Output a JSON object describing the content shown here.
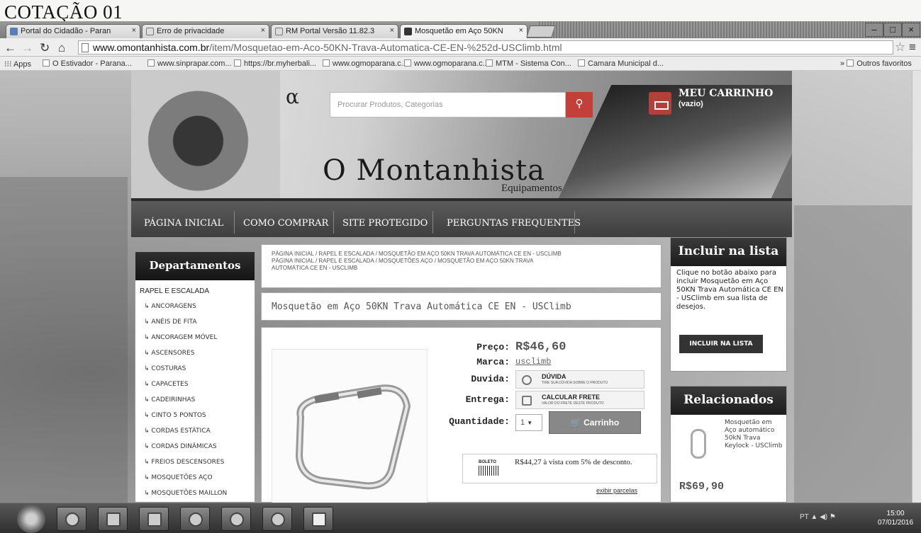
{
  "heading": "COTAÇÃO 01",
  "browser": {
    "tabs": [
      {
        "label": "Portal do Cidadão - Paran"
      },
      {
        "label": "Erro de privacidade"
      },
      {
        "label": "RM Portal Versão 11.82.3"
      },
      {
        "label": "Mosquetão em Aço 50KN"
      }
    ],
    "url_domain": "www.omontanhista.com.br",
    "url_path": "/item/Mosquetao-em-Aco-50KN-Trava-Automatica-CE-EN-%252d-USClimb.html",
    "bookmarks": [
      "Apps",
      "O Estivador - Parana...",
      "www.sinprapar.com...",
      "https://br.myherbali...",
      "www.ogmoparana.c...",
      "www.ogmoparana.c...",
      "MTM - Sistema Con...",
      "Camara Municipal d..."
    ],
    "other_bookmarks": "Outros favoritos"
  },
  "header": {
    "alpha": "α",
    "search_placeholder": "Procurar Produtos, Categorias",
    "cart_title": "MEU CARRINHO",
    "cart_sub": "(vazio)",
    "brand": "O Montanhista",
    "brand_sub": "Equipamentos"
  },
  "nav": [
    "PÁGINA INICIAL",
    "COMO COMPRAR",
    "SITE PROTEGIDO",
    "PERGUNTAS FREQUENTES"
  ],
  "departments": {
    "title": "Departamentos",
    "top": "RAPEL E ESCALADA",
    "items": [
      "ANCORAGENS",
      "ANÉIS DE FITA",
      "ANCORAGEM MÓVEL",
      "ASCENSORES",
      "COSTURAS",
      "CAPACETES",
      "CADEIRINHAS",
      "CINTO 5 PONTOS",
      "CORDAS ESTÁTICA",
      "CORDAS DINÂMICAS",
      "FREIOS DESCENSORES",
      "MOSQUETÕES AÇO",
      "MOSQUETÕES MAILLON"
    ]
  },
  "breadcrumb": {
    "line1": "PÁGINA INICIAL / RAPEL E ESCALADA / MOSQUETÃO EM AÇO 50KN TRAVA AUTOMÁTICA CE EN - USCLIMB",
    "line2": "PÁGINA INICIAL / RAPEL E ESCALADA / MOSQUETÕES AÇO / MOSQUETÃO EM AÇO 50KN TRAVA",
    "line3": "AUTOMÁTICA CE EN - USCLIMB"
  },
  "product": {
    "title": "Mosquetão em Aço 50KN Trava Automática CE EN - USClimb",
    "price_label": "Preço:",
    "price": "R$46,60",
    "brand_label": "Marca:",
    "brand": "usclimb",
    "doubt_label": "Duvida:",
    "doubt_title": "DÚVIDA",
    "doubt_sub": "TIRE SUA DÚVIDA SOBRE O PRODUTO",
    "shipping_label": "Entrega:",
    "shipping_title": "CALCULAR FRETE",
    "shipping_sub": "VALOR DO FRETE DESTE PRODUTO",
    "qty_label": "Quantidade:",
    "qty": "1",
    "cart_button": "Carrinho",
    "boleto_label": "BOLETO",
    "boleto_text": "R$44,27 à vista com 5% de desconto.",
    "installments_link": "exibir parcelas"
  },
  "wishlist": {
    "title": "Incluir na lista",
    "text": "Clique no botão abaixo para incluir Mosquetão em Aço 50KN Trava Automática CE EN - USClimb em sua lista de desejos.",
    "button": "INCLUIR NA LISTA"
  },
  "related": {
    "title": "Relacionados",
    "item": "Mosquetão em Aço automático 50kN Trava Keylock - USClimb",
    "price": "R$69,90"
  },
  "taskbar": {
    "lang": "PT",
    "time": "15:00",
    "date": "07/01/2016"
  }
}
